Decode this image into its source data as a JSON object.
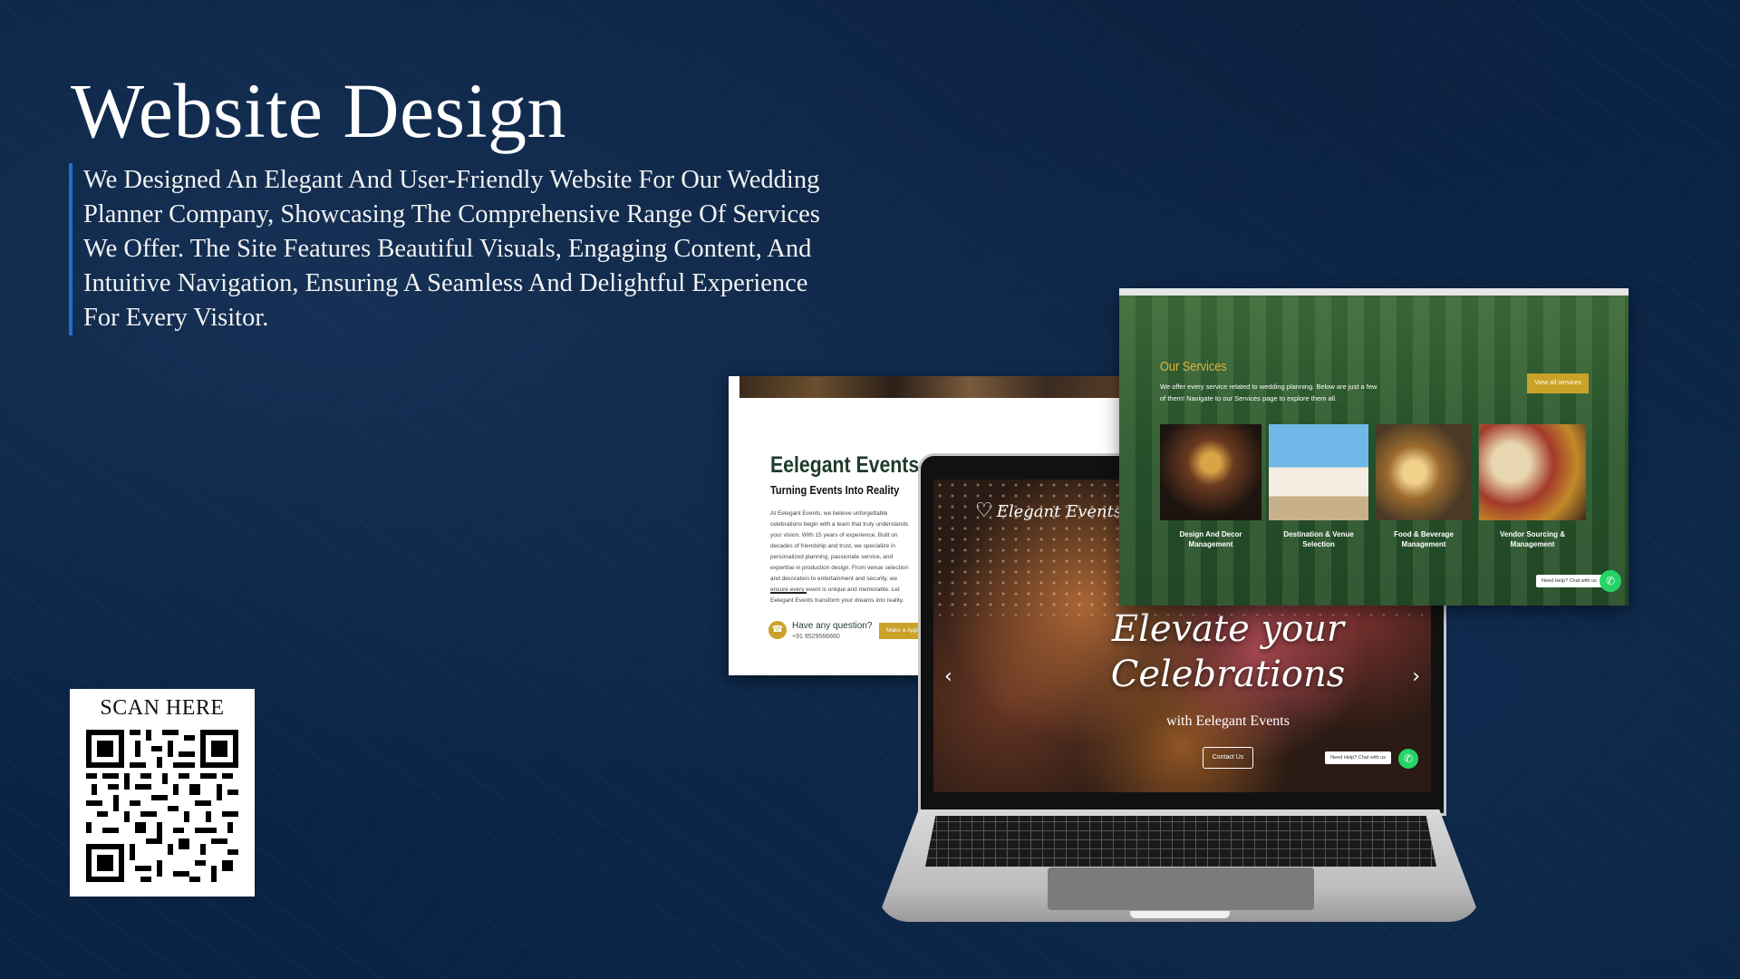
{
  "heading": "Website Design",
  "description": "We Designed An Elegant And User-Friendly Website For Our Wedding Planner Company, Showcasing The Comprehensive Range Of Services We Offer. The Site Features Beautiful Visuals, Engaging Content, And Intuitive Navigation, Ensuring A Seamless And Delightful Experience For Every Visitor.",
  "qr": {
    "label": "SCAN HERE"
  },
  "about_page": {
    "title": "Eelegant Events",
    "subtitle": "Turning Events Into Reality",
    "body": "At Eelegant Events, we believe unforgettable celebrations begin with a team that truly understands your vision. With 15 years of experience, Built on decades of friendship and trust, we specialize in personalized planning, passionate service, and expertise in production design. From venue selection and decoration to entertainment and security, we ensure every event is unique and memorable. Let Eelegant Events transform your dreams into reality.",
    "question": "Have any question?",
    "phone": "+91 9529566660",
    "button": "Make a Appointment"
  },
  "hero_page": {
    "logo": "Elegant Events",
    "title_line1": "Elevate your",
    "title_line2": "Celebrations",
    "subtitle": "with Eelegant Events",
    "button": "Contact Us",
    "help": "Need Help? Chat with us"
  },
  "services_page": {
    "title": "Our Services",
    "text": "We offer every service related to wedding planning. Below are just a few of them! Navigate to our Services page to explore them all.",
    "button": "View all services",
    "items": [
      {
        "name": "Design And Decor Management"
      },
      {
        "name": "Destination & Venue Selection"
      },
      {
        "name": "Food & Beverage Management"
      },
      {
        "name": "Vendor Sourcing & Management"
      }
    ],
    "help": "Need Help? Chat with us"
  },
  "colors": {
    "background": "#0b2343",
    "accent_gold": "#c9a227",
    "whatsapp": "#25d366",
    "services_green": "#2f5a30"
  }
}
